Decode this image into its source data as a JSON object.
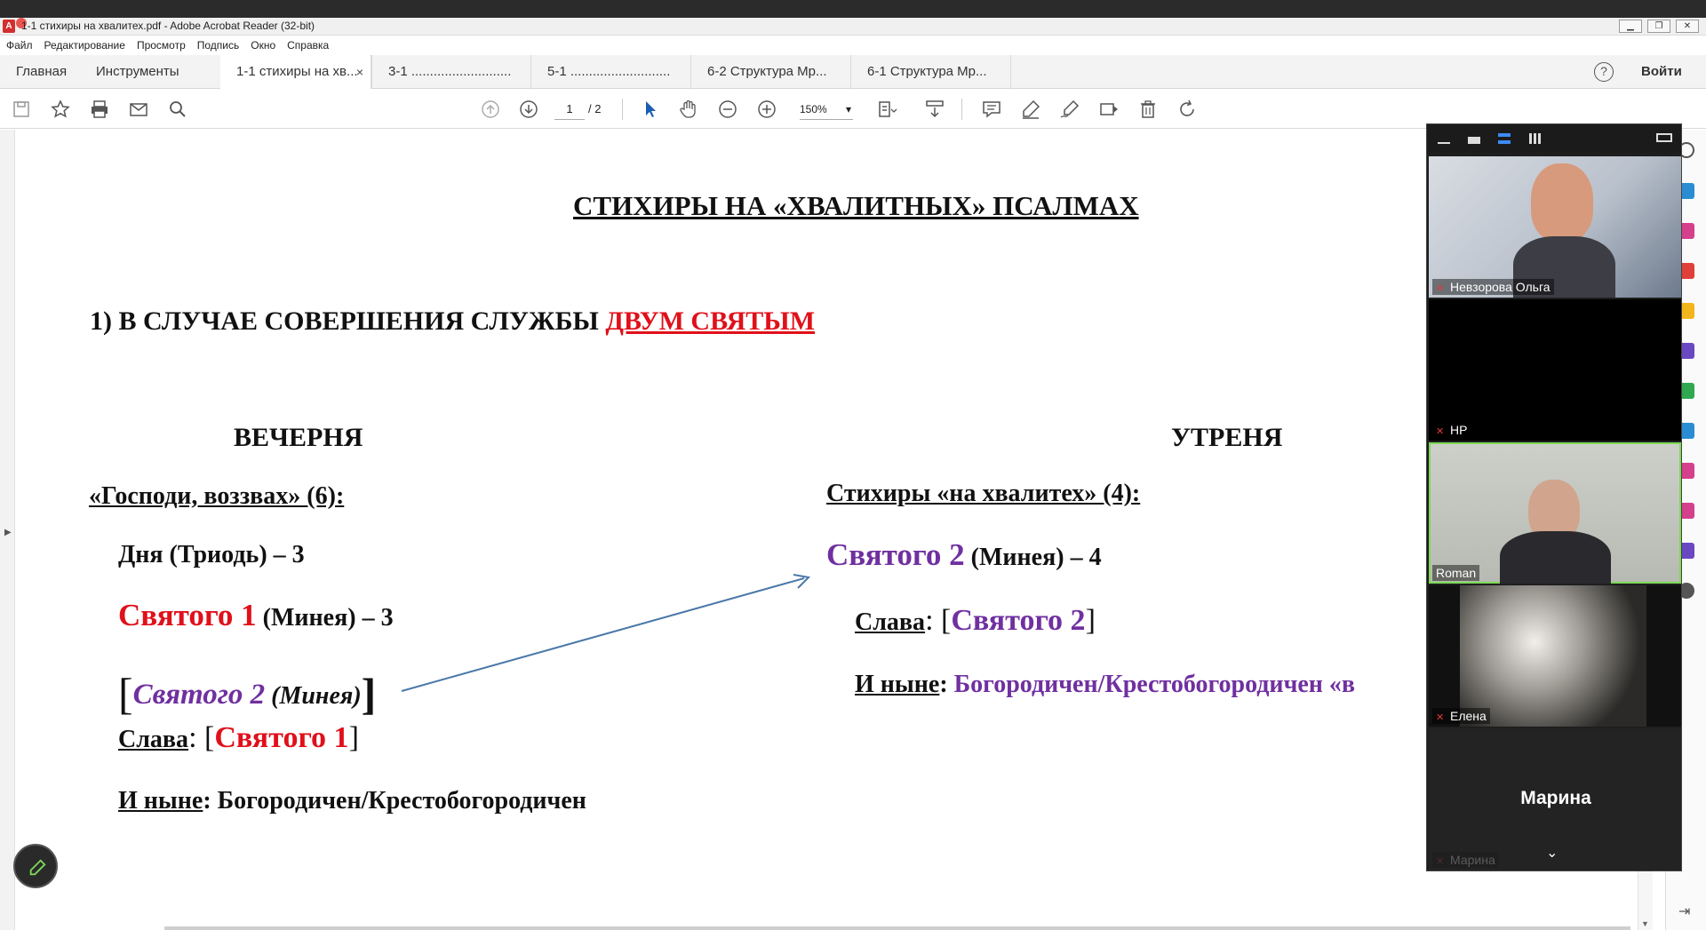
{
  "window": {
    "title": "1-1 стихиры на хвалитех.pdf - Adobe Acrobat Reader (32-bit)",
    "controls": [
      "minimize",
      "restore",
      "close"
    ]
  },
  "menu": [
    "Файл",
    "Редактирование",
    "Просмотр",
    "Подпись",
    "Окно",
    "Справка"
  ],
  "tabs": {
    "home": "Главная",
    "tools": "Инструменты",
    "documents": [
      {
        "label": "1-1 стихиры на хв...",
        "active": true
      },
      {
        "label": "3-1 ...........................",
        "active": false
      },
      {
        "label": "5-1 ...........................",
        "active": false
      },
      {
        "label": "6-2 Структура Мр...",
        "active": false
      },
      {
        "label": "6-1 Структура Мр...",
        "active": false
      }
    ],
    "close_glyph": "×",
    "help": "?",
    "login": "Войти"
  },
  "toolbar": {
    "page_current": "1",
    "page_total": "/ 2",
    "zoom": "150%",
    "icons": [
      "save-icon",
      "star-icon",
      "print-icon",
      "mail-icon",
      "search-icon",
      "page-up-icon",
      "page-down-icon",
      "select-arrow-icon",
      "hand-icon",
      "zoom-out-icon",
      "zoom-in-icon",
      "fit-page-icon",
      "scroll-mode-icon",
      "comment-icon",
      "highlight-icon",
      "sign-icon",
      "edit-icon",
      "delete-icon",
      "rotate-icon"
    ]
  },
  "document": {
    "title": "СТИХИРЫ НА «ХВАЛИТНЫХ» ПСАЛМАХ",
    "section1": {
      "prefix": "1) В СЛУЧАЕ СОВЕРШЕНИЯ СЛУЖБЫ ",
      "highlight": "ДВУМ СВЯТЫМ"
    },
    "vespers": {
      "heading": "ВЕЧЕРНЯ",
      "sub": "«Господи, воззвах» (6):",
      "line1": "Дня (Триодь) – 3",
      "line2_red": "Святого 1",
      "line2_rest": " (Минея) – 3",
      "line3_open": "[",
      "line3_purple": "Святого 2",
      "line3_rest": " (Минея)",
      "line3_close": "]",
      "glory_label": "Слава",
      "glory_colon": ": [",
      "glory_red": "Святого 1",
      "glory_close": "]",
      "now_label": "И ныне",
      "now_rest": ": Богородичен/Крестобогородичен"
    },
    "matins": {
      "heading": "УТРЕНЯ",
      "sub": "Стихиры «на хвалитех» (4):",
      "line1_purple": "Святого 2",
      "line1_rest": " (Минея) – 4",
      "glory_label": "Слава",
      "glory_colon": ": [",
      "glory_purple": "Святого 2",
      "glory_close": "]",
      "now_label": "И ныне",
      "now_colon": ": ",
      "now_purple": "Богородичен/Крестобогородичен «в"
    }
  },
  "video_call": {
    "participants": [
      {
        "name": "Невзорова Ольга",
        "muted": true,
        "active_speaker": false
      },
      {
        "name": "HP",
        "muted": true,
        "active_speaker": false
      },
      {
        "name": "Roman",
        "muted": false,
        "active_speaker": true
      },
      {
        "name": "Елена",
        "muted": true,
        "active_speaker": false
      },
      {
        "name": "Марина",
        "muted": true,
        "active_speaker": false
      }
    ],
    "accent": "#7ed957"
  },
  "colors": {
    "red": "#e0101a",
    "purple": "#7030a0",
    "arrow": "#4a78a8"
  }
}
